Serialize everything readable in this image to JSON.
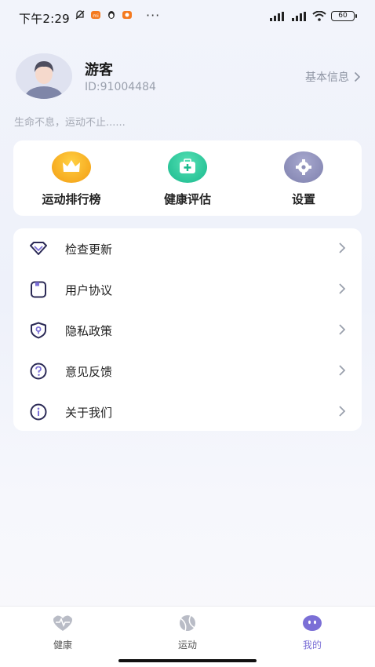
{
  "status_bar": {
    "time": "下午2:29",
    "battery": "60"
  },
  "profile": {
    "name": "游客",
    "id": "ID:91004484",
    "basic_info_label": "基本信息",
    "motto": "生命不息，运动不止......"
  },
  "quick_actions": [
    {
      "label": "运动排行榜",
      "icon": "crown-icon",
      "color": "#f6a313"
    },
    {
      "label": "健康评估",
      "icon": "medical-kit-icon",
      "color": "#22c39a"
    },
    {
      "label": "设置",
      "icon": "gear-icon",
      "color": "#8d8fb8"
    }
  ],
  "menu": [
    {
      "label": "检查更新",
      "icon": "diamond-icon"
    },
    {
      "label": "用户协议",
      "icon": "document-icon"
    },
    {
      "label": "隐私政策",
      "icon": "shield-icon"
    },
    {
      "label": "意见反馈",
      "icon": "question-icon"
    },
    {
      "label": "关于我们",
      "icon": "info-icon"
    }
  ],
  "tabs": [
    {
      "label": "健康",
      "icon": "heart-pulse-icon",
      "active": false
    },
    {
      "label": "运动",
      "icon": "ball-icon",
      "active": false
    },
    {
      "label": "我的",
      "icon": "face-icon",
      "active": true
    }
  ],
  "colors": {
    "accent": "#7b6fd6",
    "icon_stroke": "#2b2a56",
    "muted_text": "#9aa0ad"
  }
}
